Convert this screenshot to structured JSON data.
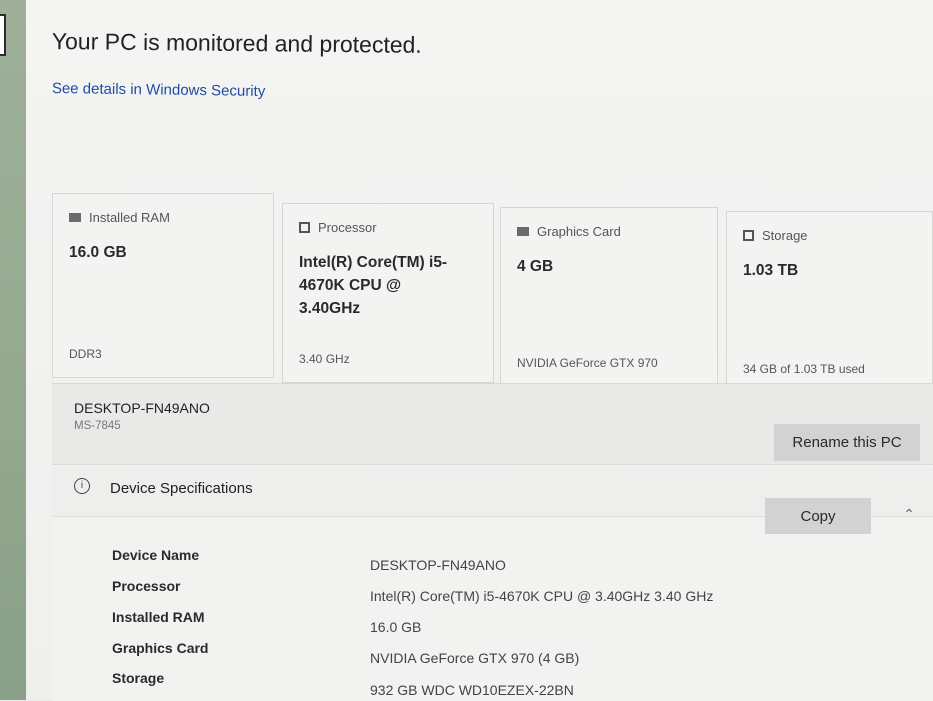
{
  "status": {
    "title": "Your PC is monitored and protected.",
    "link": "See details in Windows Security"
  },
  "cards": [
    {
      "icon": "ram-icon",
      "label": "Installed RAM",
      "value": "16.0 GB",
      "sub": "DDR3"
    },
    {
      "icon": "processor-icon",
      "label": "Processor",
      "value": "Intel(R) Core(TM) i5-4670K CPU @ 3.40GHz",
      "sub": "3.40 GHz"
    },
    {
      "icon": "graphics-card-icon",
      "label": "Graphics Card",
      "value": "4 GB",
      "sub": "NVIDIA GeForce GTX 970"
    },
    {
      "icon": "storage-icon",
      "label": "Storage",
      "value": "1.03 TB",
      "sub": "34 GB of 1.03 TB used"
    }
  ],
  "pc": {
    "name": "DESKTOP-FN49ANO",
    "model": "MS-7845",
    "rename_label": "Rename this PC"
  },
  "device_specs": {
    "title": "Device Specifications",
    "copy_label": "Copy",
    "rows": [
      {
        "label": "Device Name",
        "value": "DESKTOP-FN49ANO"
      },
      {
        "label": "Processor",
        "value": "Intel(R) Core(TM) i5-4670K CPU @ 3.40GHz   3.40 GHz"
      },
      {
        "label": "Installed RAM",
        "value": "16.0 GB"
      },
      {
        "label": "Graphics Card",
        "value": "NVIDIA GeForce GTX 970 (4 GB)"
      },
      {
        "label": "Storage",
        "value": "932 GB WDC WD10EZEX-22BN"
      }
    ]
  }
}
